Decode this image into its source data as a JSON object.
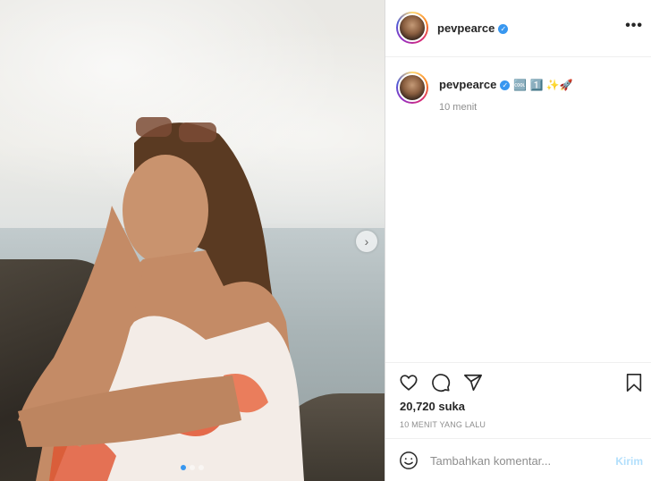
{
  "post": {
    "username": "pevpearce",
    "verified": true,
    "more_icon": "more-horizontal-icon"
  },
  "caption": {
    "username": "pevpearce",
    "emojis": "🆒 1️⃣ ✨🚀",
    "time": "10 menit"
  },
  "stats": {
    "likes": "20,720 suka",
    "posted": "10 MENIT YANG LALU"
  },
  "comment": {
    "placeholder": "Tambahkan komentar...",
    "post_label": "Kirim"
  },
  "carousel": {
    "slides": 3,
    "active_index": 0
  },
  "colors": {
    "verified": "#3897f0",
    "text": "#262626",
    "muted": "#8e8e8e",
    "post_disabled": "#b2dffc"
  }
}
